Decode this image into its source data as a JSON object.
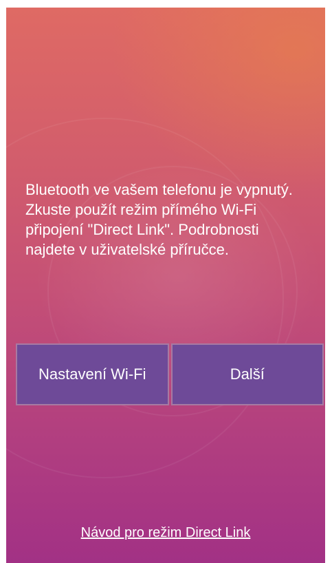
{
  "dialog": {
    "message": "Bluetooth ve vašem telefonu je vypnutý. Zkuste použít režim přímého Wi-Fi připojení \"Direct Link\". Podrobnosti najdete v uživatelské příručce.",
    "wifi_settings_label": "Nastavení Wi-Fi",
    "next_label": "Další",
    "guide_link": "Návod pro režim Direct Link"
  },
  "colors": {
    "background_top": "#df6a64",
    "background_bottom": "#a23185",
    "button_fill": "#6e4a98",
    "button_border": "#a77aa3",
    "text": "#ffffff"
  }
}
